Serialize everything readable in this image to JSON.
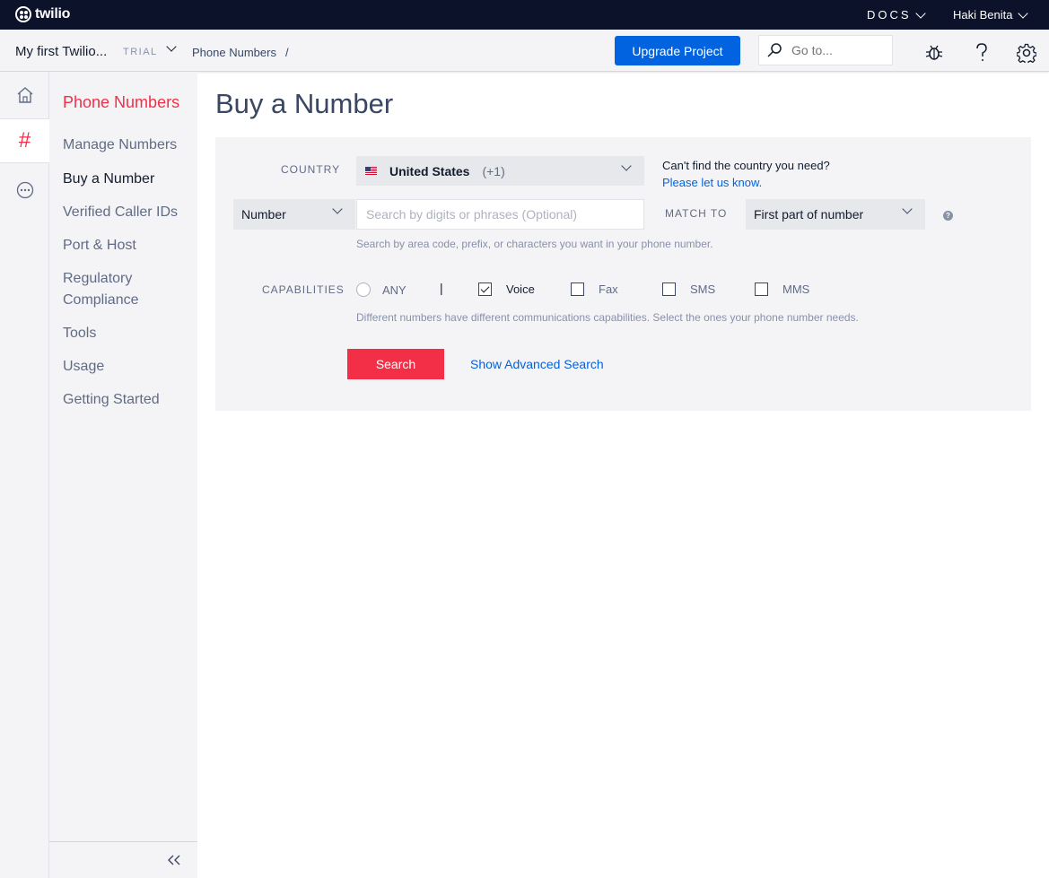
{
  "topbar": {
    "logo_text": "twilio",
    "docs_label": "DOCS",
    "user_name": "Haki Benita"
  },
  "subbar": {
    "project_name": "My first Twilio...",
    "plan_badge": "TRIAL",
    "breadcrumb": "Phone Numbers",
    "breadcrumb_sep": "/",
    "upgrade_label": "Upgrade Project",
    "goto_placeholder": "Go to...",
    "icons": [
      "bug-icon",
      "help-icon",
      "gear-icon"
    ]
  },
  "rail": {
    "items": [
      "home-icon",
      "hash-icon",
      "more-icon"
    ],
    "active_glyph": "#"
  },
  "sidebar": {
    "title": "Phone Numbers",
    "items": [
      {
        "label": "Manage Numbers"
      },
      {
        "label": "Buy a Number"
      },
      {
        "label": "Verified Caller IDs"
      },
      {
        "label": "Port & Host"
      },
      {
        "label": "Regulatory Compliance"
      },
      {
        "label": "Tools"
      },
      {
        "label": "Usage"
      },
      {
        "label": "Getting Started"
      }
    ],
    "active_item": "Buy a Number"
  },
  "main": {
    "title": "Buy a Number",
    "country_label": "COUNTRY",
    "country_name": "United States",
    "country_code": "(+1)",
    "cant_find": "Can't find the country you need?",
    "let_us_know": "Please let us know.",
    "search_type": "Number",
    "search_placeholder": "Search by digits or phrases (Optional)",
    "match_label": "MATCH TO",
    "match_value": "First part of number",
    "help_glyph": "?",
    "search_hint": "Search by area code, prefix, or characters you want in your phone number.",
    "capabilities_label": "CAPABILITIES",
    "capabilities": {
      "any": "ANY",
      "separator": "|",
      "voice": "Voice",
      "fax": "Fax",
      "sms": "SMS",
      "mms": "MMS"
    },
    "capabilities_checked": [
      "Voice"
    ],
    "capabilities_hint": "Different numbers have different communications capabilities. Select the ones your phone number needs.",
    "search_button": "Search",
    "advanced_link": "Show Advanced Search"
  },
  "colors": {
    "brand_red": "#f22f46",
    "link_blue": "#0263e0",
    "topbar": "#0d122b"
  }
}
